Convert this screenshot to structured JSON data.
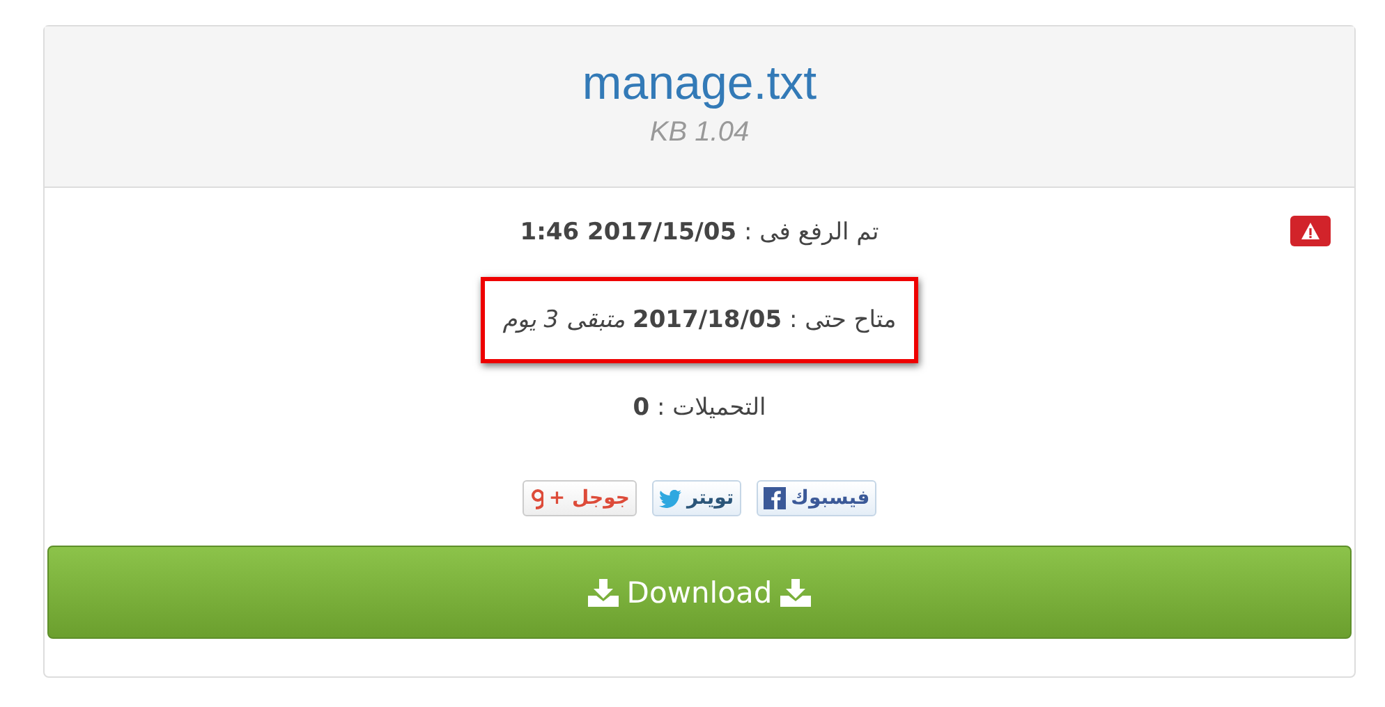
{
  "file": {
    "name": "manage.txt",
    "size": "KB 1.04"
  },
  "alert": {
    "kind": "warning"
  },
  "details": [
    {
      "text": "تم الرفع فى : **2017/15/05 1:46**",
      "highlighted": false
    },
    {
      "text": "متاح حتى : **2017/18/05** *متبقى 3 يوم*",
      "highlighted": true
    },
    {
      "text": "التحميلات : **0**",
      "highlighted": false
    }
  ],
  "share": [
    {
      "kind": "facebook",
      "label": "فيسبوك"
    },
    {
      "kind": "twitter",
      "label": "تويتر"
    },
    {
      "kind": "google",
      "label": "جوجل +"
    }
  ],
  "download": {
    "label": "Download"
  }
}
